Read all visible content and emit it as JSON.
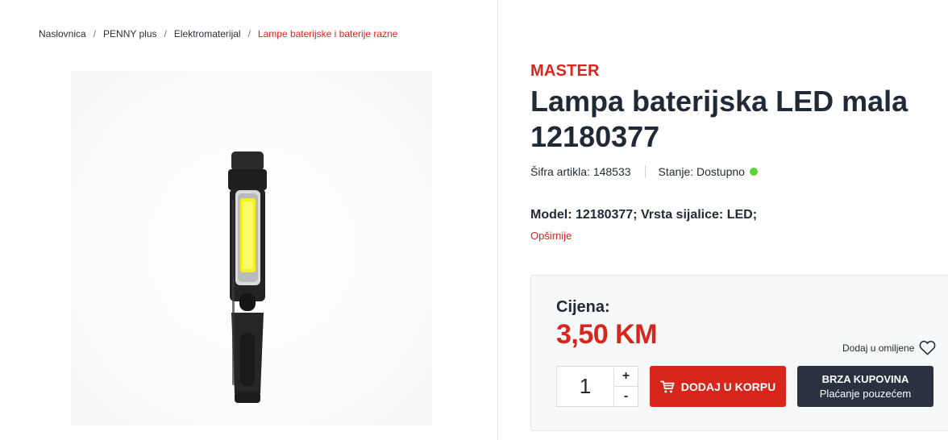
{
  "breadcrumb": {
    "items": [
      "Naslovnica",
      "PENNY plus",
      "Elektromaterijal",
      "Lampe baterijske i baterije razne"
    ],
    "separator": "/"
  },
  "product": {
    "brand": "MASTER",
    "title": "Lampa baterijska LED mala 12180377",
    "sku_label": "Šifra artikla:",
    "sku": "148533",
    "stock_label": "Stanje:",
    "stock_value": "Dostupno",
    "stock_color": "#5ad334",
    "specs": "Model: 12180377; Vrsta sijalice: LED;",
    "more_link": "Opširnije",
    "image_icon": "flashlight-image"
  },
  "purchase": {
    "price_label": "Cijena:",
    "price": "3,50 KM",
    "favorite_label": "Dodaj u omiljene",
    "quantity": "1",
    "plus": "+",
    "minus": "-",
    "add_to_cart": "DODAJ U KORPU",
    "quick_buy_title": "BRZA KUPOVINA",
    "quick_buy_sub": "Plaćanje pouzećem"
  },
  "colors": {
    "accent": "#d9261c",
    "dark_button": "#2a3240",
    "text": "#1f2937"
  }
}
